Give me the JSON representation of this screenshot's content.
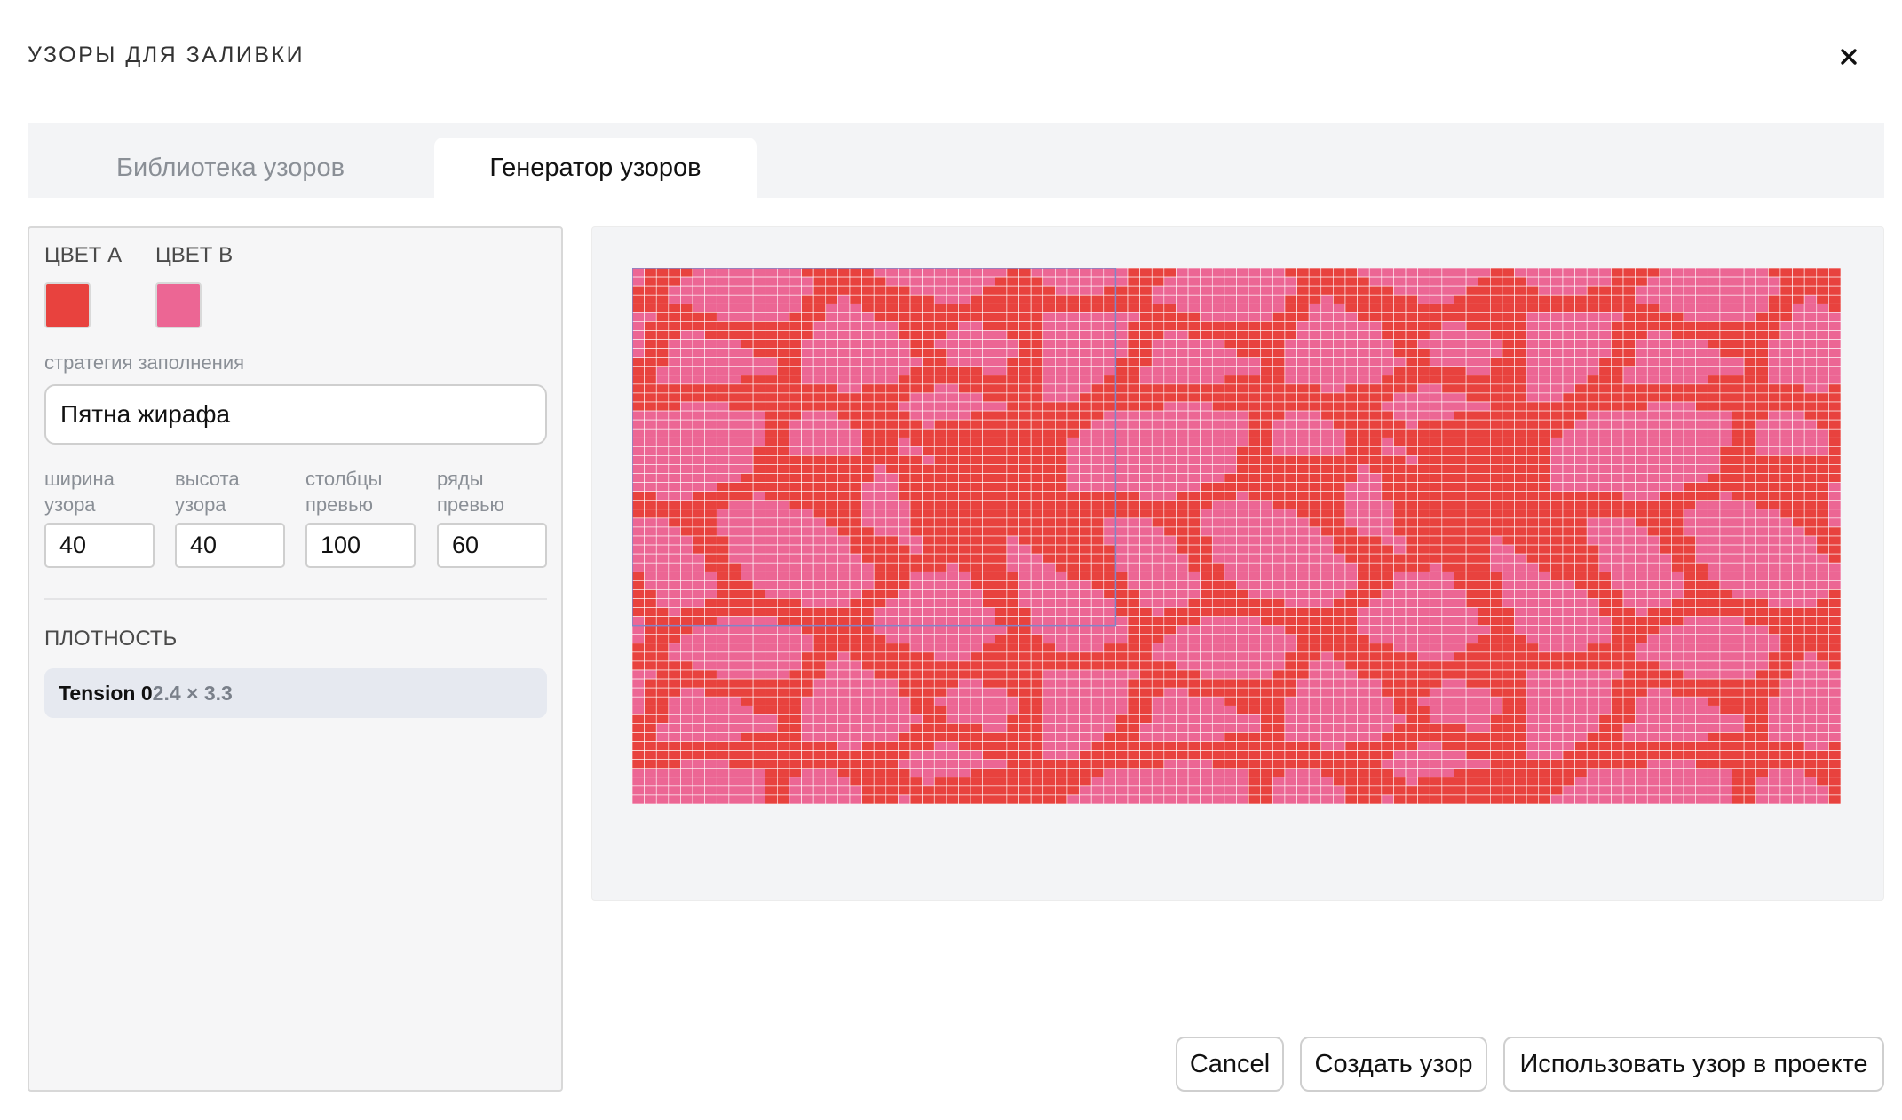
{
  "dialog": {
    "title": "УЗОРЫ ДЛЯ ЗАЛИВКИ",
    "close_icon": "close-icon"
  },
  "tabs": [
    {
      "label": "Библиотека узоров",
      "active": false
    },
    {
      "label": "Генератор узоров",
      "active": true
    }
  ],
  "settings": {
    "color_a_label": "ЦВЕТ A",
    "color_b_label": "ЦВЕТ B",
    "color_a": "#e8423e",
    "color_b": "#ec6694",
    "strategy_label": "стратегия заполнения",
    "strategy_value": "Пятна жирафа",
    "fields": [
      {
        "label_line1": "ширина",
        "label_line2": "узора",
        "value": "40"
      },
      {
        "label_line1": "высота",
        "label_line2": "узора",
        "value": "40"
      },
      {
        "label_line1": "столбцы",
        "label_line2": "превью",
        "value": "100"
      },
      {
        "label_line1": "ряды",
        "label_line2": "превью",
        "value": "60"
      }
    ],
    "density_label": "ПЛОТНОСТЬ",
    "density_name": "Tension 0",
    "density_value": "2.4 × 3.3"
  },
  "preview": {
    "columns": 100,
    "rows": 60,
    "pattern_width": 40,
    "pattern_height": 40,
    "grid_line_color": "#ffffff",
    "repeat_outline_color": "#7f86c9"
  },
  "buttons": {
    "cancel": "Cancel",
    "create": "Создать узор",
    "use": "Использовать узор в проекте"
  }
}
